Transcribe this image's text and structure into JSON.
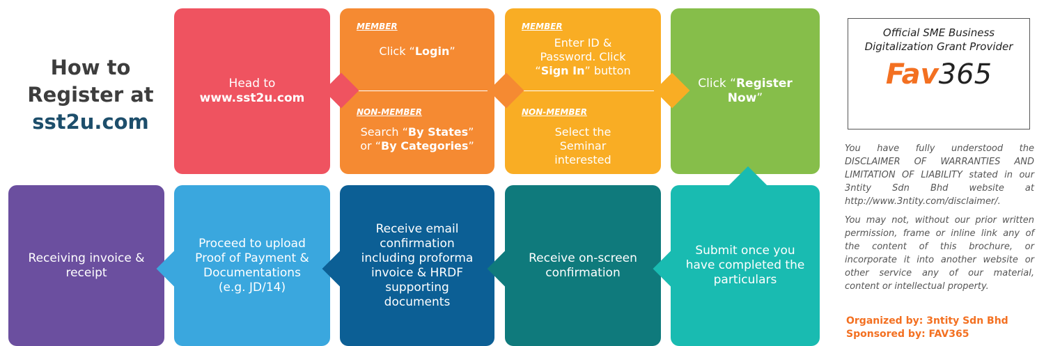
{
  "heading": {
    "line1": "How to",
    "line2": "Register at",
    "line3": "sst2u.com"
  },
  "steps": {
    "s1": {
      "prefix": "Head to",
      "bold": "www.sst2u.com"
    },
    "s2": {
      "member_tag": "MEMBER",
      "member_pre": "Click “",
      "member_bold": "Login",
      "member_post": "”",
      "nonmember_tag": "NON-MEMBER",
      "nonmember_pre1": "Search “",
      "nonmember_bold1": "By States",
      "nonmember_mid": "” or “",
      "nonmember_bold2": "By Categories",
      "nonmember_post": "”"
    },
    "s3": {
      "member_tag": "MEMBER",
      "member_pre": "Enter ID & Password. Click “",
      "member_bold": "Sign In",
      "member_post": "” button",
      "nonmember_tag": "NON-MEMBER",
      "nonmember_text": "Select the Seminar interested"
    },
    "s4": {
      "prefix": "Click “",
      "bold": "Register Now",
      "suffix": "”"
    },
    "s5": {
      "text": "Submit once you have completed the particulars"
    },
    "s6": {
      "text": "Receive on-screen confirmation"
    },
    "s7": {
      "text": "Receive email confirmation including proforma invoice & HRDF supporting documents"
    },
    "s8": {
      "text": "Proceed to upload Proof of Payment & Documentations (e.g. JD/14)"
    },
    "s9": {
      "text": "Receiving invoice & receipt"
    }
  },
  "colors": {
    "s1": "#ef5360",
    "s2": "#f58a32",
    "s3": "#f9ad24",
    "s4": "#86be4a",
    "s5": "#19bbb1",
    "s6": "#0f7a7c",
    "s7": "#0c5f95",
    "s8": "#3aa7de",
    "s9": "#6b4f9f"
  },
  "sidebar": {
    "caption": "Official SME Business Digitalization Grant Provider",
    "logo_fav": "Fav",
    "logo_num": "365",
    "disclaimer1": "You have fully understood the DISCLAIMER OF WARRANTIES AND LIMITATION OF LIABILITY stated in our 3ntity Sdn Bhd website at http://www.3ntity.com/disclaimer/.",
    "disclaimer2": "You may not, without our prior written permission, frame or inline link any of the content of this brochure, or incorporate it into another website or other service any of our material, content or intellectual property.",
    "organized": "Organized by:  3ntity Sdn Bhd",
    "sponsored": "Sponsored by:  FAV365"
  }
}
